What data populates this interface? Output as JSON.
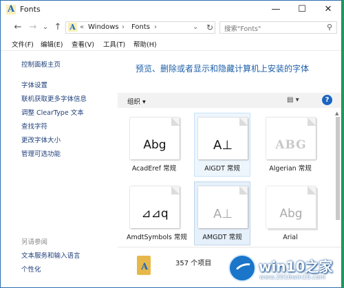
{
  "window": {
    "title": "Fonts",
    "icon": "font-folder-icon",
    "controls": {
      "minimize": "—",
      "maximize": "☐",
      "close": "✕"
    }
  },
  "nav": {
    "back": "←",
    "forward": "→",
    "recent": "⌄",
    "up": "↑",
    "breadcrumb": {
      "overflow": "«",
      "items": [
        "Windows",
        "Fonts"
      ],
      "separator": "›",
      "dropdown": "⌄"
    },
    "refresh": "↻",
    "search_placeholder": "搜索\"Fonts\"",
    "search_icon": "⚲"
  },
  "menu": [
    "文件(F)",
    "编辑(E)",
    "查看(V)",
    "工具(T)",
    "帮助(H)"
  ],
  "sidebar": {
    "home": "控制面板主页",
    "links": [
      "字体设置",
      "联机获取更多字体信息",
      "调整 ClearType 文本",
      "查找字符",
      "更改字体大小",
      "管理可选功能"
    ],
    "see_also_title": "另请参阅",
    "see_also": [
      "文本服务和输入语言",
      "个性化"
    ]
  },
  "main": {
    "heading": "预览、删除或者显示和隐藏计算机上安装的字体",
    "organize": "组织 ▾",
    "view": "▤ ▾",
    "help": "?"
  },
  "fonts": [
    {
      "name": "AcadEref 常规",
      "sample": "Abg"
    },
    {
      "name": "AIGDT 常规",
      "sample": "A⊥"
    },
    {
      "name": "Algerian 常规",
      "sample": "ABG"
    },
    {
      "name": "AmdtSymbols 常规",
      "sample": "⊿⊿q"
    },
    {
      "name": "AMGDT 常规",
      "sample": "A⊥"
    },
    {
      "name": "Arial",
      "sample": "Abg"
    }
  ],
  "status": {
    "count": "357 个项目",
    "folder_letter": "A"
  },
  "watermark": {
    "title": "win10之家",
    "url": "www.2016win10.com"
  },
  "colors": {
    "accent": "#1b64c2",
    "heading": "#1e5fa8",
    "desktop": "#1f9a5a",
    "folder": "#e6b84a"
  }
}
